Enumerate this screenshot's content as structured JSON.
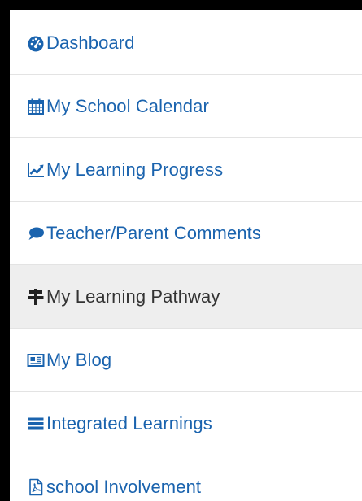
{
  "colors": {
    "link": "#1a63ae",
    "active_text": "#333333",
    "active_bg": "#eeeeee",
    "divider": "#e3e3e3",
    "frame": "#000000"
  },
  "menu": {
    "items": [
      {
        "label": "Dashboard",
        "icon": "tachometer-icon",
        "active": false
      },
      {
        "label": "My School Calendar",
        "icon": "calendar-icon",
        "active": false
      },
      {
        "label": "My Learning Progress",
        "icon": "line-chart-icon",
        "active": false
      },
      {
        "label": "Teacher/Parent Comments",
        "icon": "comment-icon",
        "active": false
      },
      {
        "label": "My Learning Pathway",
        "icon": "signpost-icon",
        "active": true
      },
      {
        "label": "My Blog",
        "icon": "newspaper-icon",
        "active": false
      },
      {
        "label": "Integrated Learnings",
        "icon": "list-icon",
        "active": false
      },
      {
        "label": "school Involvement",
        "icon": "pdf-file-icon",
        "active": false
      }
    ]
  }
}
